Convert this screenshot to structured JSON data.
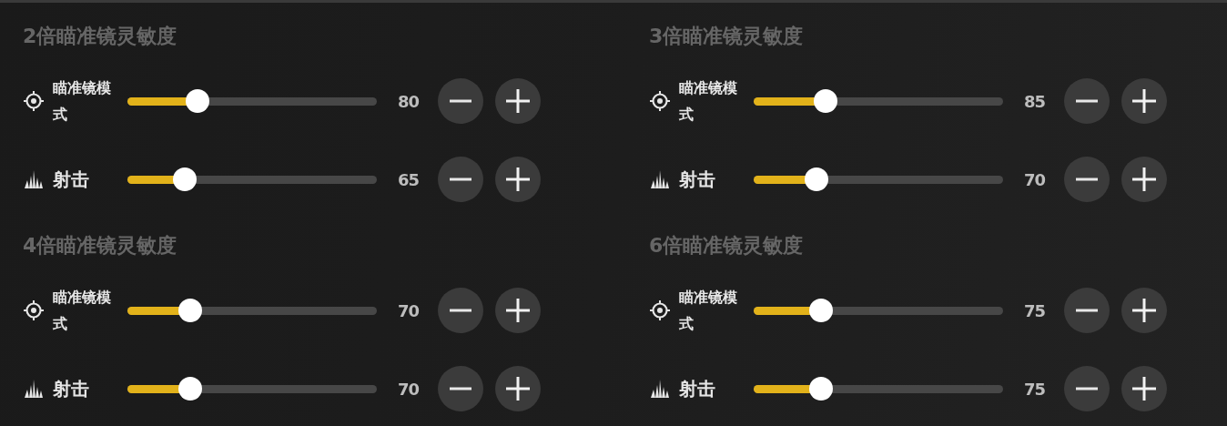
{
  "sections": [
    {
      "title": "2倍瞄准镜灵敏度",
      "rows": [
        {
          "kind": "scope",
          "label": "瞄准镜模式",
          "value": "80",
          "level": 0.28
        },
        {
          "kind": "fire",
          "label": "射击",
          "value": "65",
          "level": 0.23
        }
      ]
    },
    {
      "title": "3倍瞄准镜灵敏度",
      "rows": [
        {
          "kind": "scope",
          "label": "瞄准镜模式",
          "value": "85",
          "level": 0.29
        },
        {
          "kind": "fire",
          "label": "射击",
          "value": "70",
          "level": 0.25
        }
      ]
    },
    {
      "title": "4倍瞄准镜灵敏度",
      "rows": [
        {
          "kind": "scope",
          "label": "瞄准镜模式",
          "value": "70",
          "level": 0.25
        },
        {
          "kind": "fire",
          "label": "射击",
          "value": "70",
          "level": 0.25
        }
      ]
    },
    {
      "title": "6倍瞄准镜灵敏度",
      "rows": [
        {
          "kind": "scope",
          "label": "瞄准镜模式",
          "value": "75",
          "level": 0.27
        },
        {
          "kind": "fire",
          "label": "射击",
          "value": "75",
          "level": 0.27
        }
      ]
    }
  ]
}
